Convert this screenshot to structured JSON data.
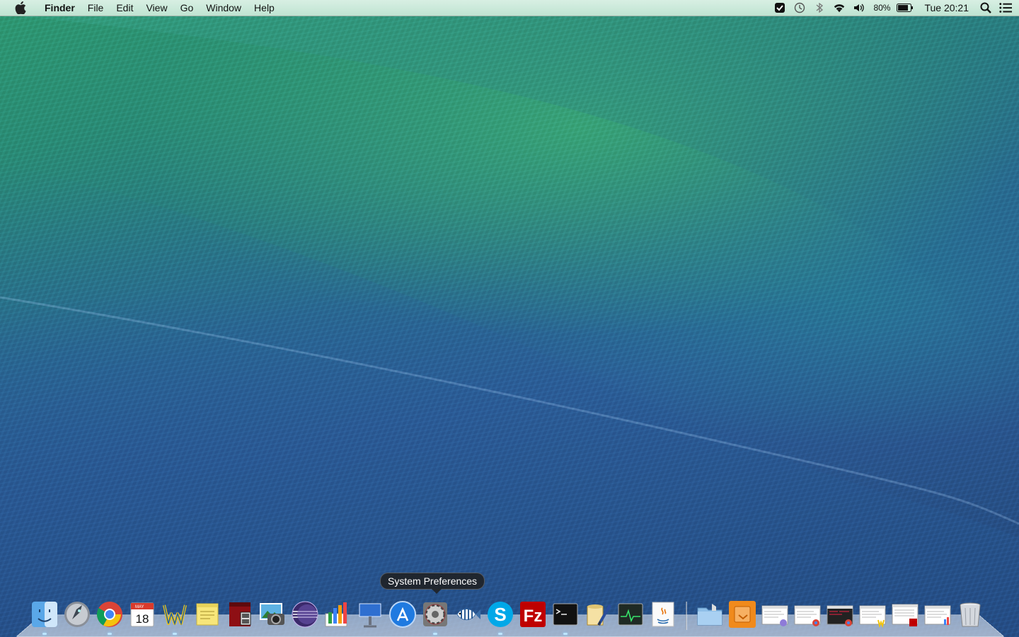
{
  "menubar": {
    "app_name": "Finder",
    "menus": [
      "File",
      "Edit",
      "View",
      "Go",
      "Window",
      "Help"
    ],
    "battery_percent": "80%",
    "clock": "Tue 20:21"
  },
  "dock": {
    "tooltip": "System Preferences",
    "calendar_day": "18",
    "calendar_month": "MAY",
    "apps": [
      {
        "name": "Finder",
        "icon": "finder-icon",
        "running": true
      },
      {
        "name": "Launchpad",
        "icon": "rocket-icon",
        "running": false
      },
      {
        "name": "Google Chrome",
        "icon": "chrome-icon",
        "running": true
      },
      {
        "name": "Calendar",
        "icon": "calendar-icon",
        "running": false
      },
      {
        "name": "TextWrangler",
        "icon": "textwrangler-icon",
        "running": true
      },
      {
        "name": "Stickies",
        "icon": "stickies-icon",
        "running": false
      },
      {
        "name": "Photo Booth",
        "icon": "photobooth-icon",
        "running": false
      },
      {
        "name": "iPhoto",
        "icon": "iphoto-icon",
        "running": false
      },
      {
        "name": "Eclipse",
        "icon": "eclipse-icon",
        "running": false
      },
      {
        "name": "Numbers",
        "icon": "numbers-icon",
        "running": false
      },
      {
        "name": "Keynote",
        "icon": "keynote-icon",
        "running": false
      },
      {
        "name": "App Store",
        "icon": "appstore-icon",
        "running": false
      },
      {
        "name": "System Preferences",
        "icon": "gear-icon",
        "running": true
      },
      {
        "name": "Aquarium",
        "icon": "fish-icon",
        "running": false
      },
      {
        "name": "Skype",
        "icon": "skype-icon",
        "running": true
      },
      {
        "name": "FileZilla",
        "icon": "filezilla-icon",
        "running": false
      },
      {
        "name": "Terminal",
        "icon": "terminal-icon",
        "running": true
      },
      {
        "name": "Script Editor",
        "icon": "script-editor-icon",
        "running": false
      },
      {
        "name": "Activity Monitor",
        "icon": "activity-monitor-icon",
        "running": false
      },
      {
        "name": "Java",
        "icon": "java-icon",
        "running": false
      }
    ],
    "stacks": [
      {
        "name": "Applications",
        "icon": "folder-icon"
      },
      {
        "name": "Downloads",
        "icon": "downloads-stack-icon"
      },
      {
        "name": "Minimized window 1",
        "icon": "window-thumbnail-icon"
      },
      {
        "name": "Minimized window 2",
        "icon": "window-thumbnail-icon"
      },
      {
        "name": "Minimized window 3",
        "icon": "window-thumbnail-icon"
      },
      {
        "name": "Minimized window 4",
        "icon": "window-thumbnail-icon"
      },
      {
        "name": "Minimized window 5",
        "icon": "window-thumbnail-icon"
      },
      {
        "name": "Minimized window 6",
        "icon": "window-thumbnail-icon"
      },
      {
        "name": "Trash",
        "icon": "trash-icon"
      }
    ]
  }
}
